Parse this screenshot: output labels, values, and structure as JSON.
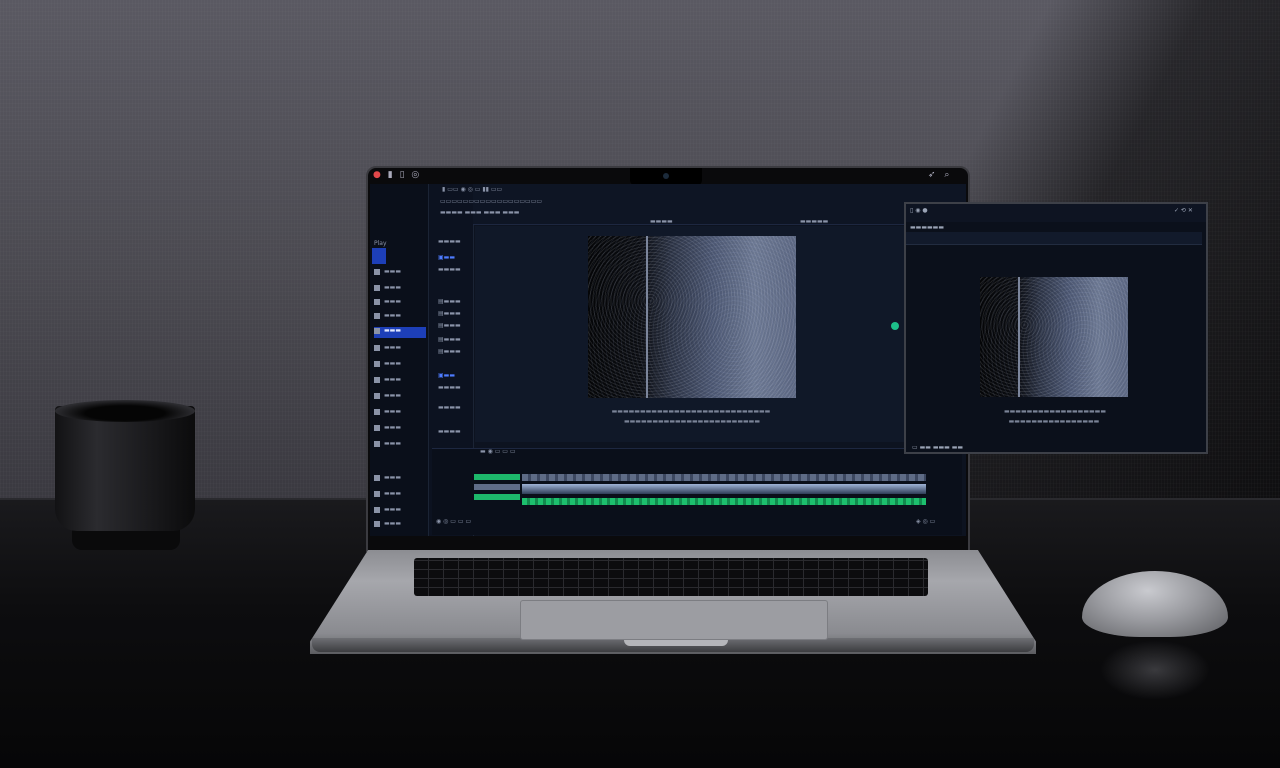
{
  "scene": {
    "description_tag": "laptop-with-video-editor-and-external-monitor",
    "colors": {
      "wall": "#4f4e56",
      "desk": "#0d0d0f",
      "ui_background": "#0d1320",
      "accent_blue": "#1d3fb8",
      "accent_green": "#1dbf6e"
    }
  },
  "laptop": {
    "sidebar": {
      "section_label": "Play",
      "items": [
        "",
        "",
        "",
        "",
        "",
        "",
        "",
        "",
        "",
        "",
        "",
        "",
        ""
      ]
    },
    "icons": [
      "app-logo-icon",
      "settings-icon",
      "search-icon",
      "play-icon"
    ]
  },
  "external_monitor": {
    "controls": [
      "",
      "",
      ""
    ]
  }
}
